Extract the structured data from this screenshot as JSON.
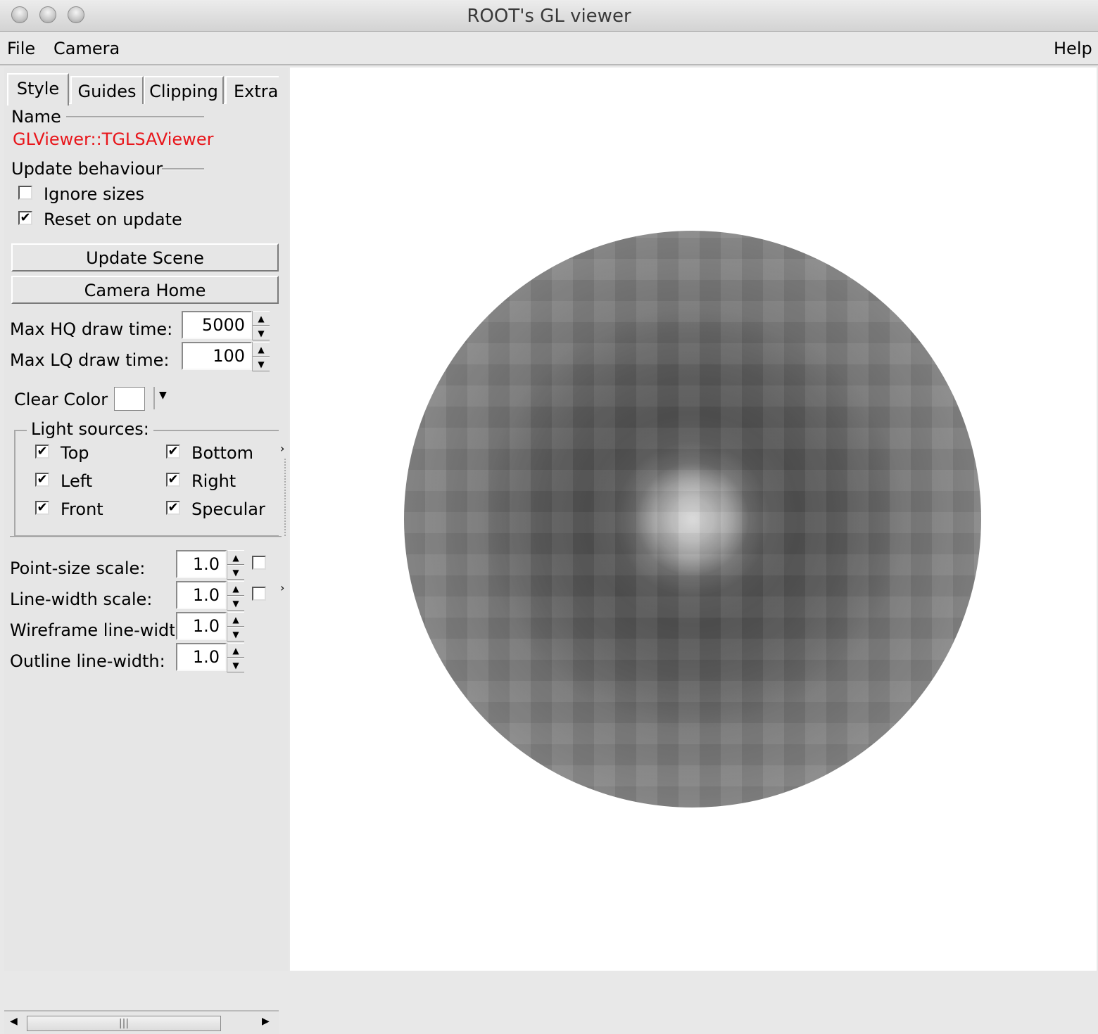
{
  "window": {
    "title": "ROOT's GL viewer"
  },
  "menu": {
    "file": "File",
    "camera": "Camera",
    "help": "Help"
  },
  "tabs": [
    {
      "label": "Style"
    },
    {
      "label": "Guides"
    },
    {
      "label": "Clipping"
    },
    {
      "label": "Extras"
    }
  ],
  "style": {
    "name_label": "Name",
    "name_value": "GLViewer::TGLSAViewer",
    "update_label": "Update behaviour",
    "ignore_sizes": "Ignore sizes",
    "reset_on_update": "Reset on update",
    "update_scene": "Update Scene",
    "camera_home": "Camera Home",
    "max_hq_label": "Max HQ draw time:",
    "max_hq_value": "5000",
    "max_lq_label": "Max LQ draw time:",
    "max_lq_value": "100",
    "clear_color_label": "Clear Color",
    "light_sources_label": "Light sources:",
    "lights": {
      "top": "Top",
      "bottom": "Bottom",
      "left": "Left",
      "right": "Right",
      "front": "Front",
      "specular": "Specular"
    },
    "point_size_label": "Point-size scale:",
    "point_size_value": "1.0",
    "line_width_label": "Line-width scale:",
    "line_width_value": "1.0",
    "wireframe_label": "Wireframe line-width",
    "wireframe_value": "1.0",
    "outline_label": "Outline line-width:",
    "outline_value": "1.0"
  },
  "colors": {
    "name_value": "#e8161b",
    "viewer_bg": "#ffffff"
  }
}
